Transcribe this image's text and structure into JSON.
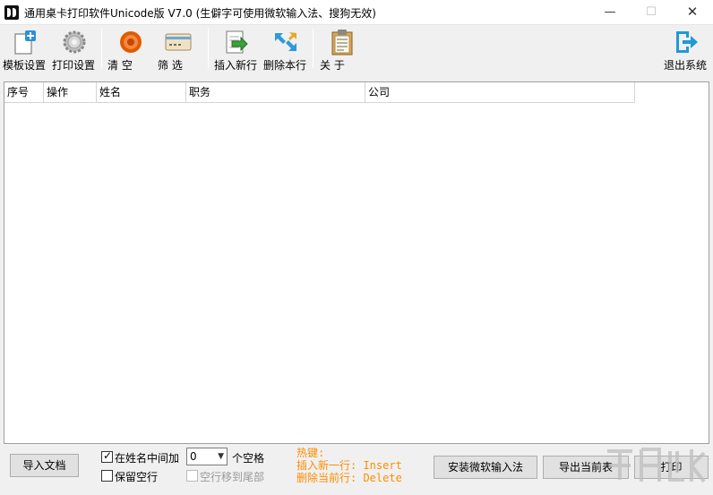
{
  "window": {
    "title": "通用桌卡打印软件Unicode版  V7.0  (生僻字可使用微软输入法、搜狗无效)",
    "minimize_glyph": "—",
    "maximize_glyph": "☐",
    "close_glyph": "✕"
  },
  "toolbar": {
    "template_settings": "模板设置",
    "print_settings": "打印设置",
    "clear": "清    空",
    "filter": "筛    选",
    "insert_row": "插入新行",
    "delete_row": "删除本行",
    "about": "关    于",
    "exit": "退出系统"
  },
  "grid": {
    "columns": [
      "序号",
      "操作",
      "姓名",
      "职务",
      "公司"
    ]
  },
  "bottom": {
    "import_doc": "导入文档",
    "insert_in_name": "在姓名中间加",
    "spaces_value": "0",
    "spaces_suffix": "个空格",
    "keep_empty_rows": "保留空行",
    "move_empty_to_end": "空行移到尾部",
    "hotkeys": "热键:\n插入新一行: Insert\n删除当前行: Delete",
    "install_ime": "安装微软输入法",
    "export_table": "导出当前表",
    "print": "打印"
  },
  "state": {
    "insert_in_name_checked": true,
    "keep_empty_rows_checked": false,
    "move_empty_to_end_checked": false,
    "move_empty_to_end_enabled": false
  },
  "colors": {
    "hotkey_text": "#ff8c00",
    "exit_icon": "#1e9ad6",
    "clear_icon": "#e05a00"
  },
  "icons": {
    "template_settings": "document-plus-icon",
    "print_settings": "gear-icon",
    "clear": "red-disc-icon",
    "filter": "card-icon",
    "insert_row": "document-arrow-icon",
    "delete_row": "arrows-icon",
    "about": "clipboard-icon",
    "exit": "exit-door-icon"
  }
}
